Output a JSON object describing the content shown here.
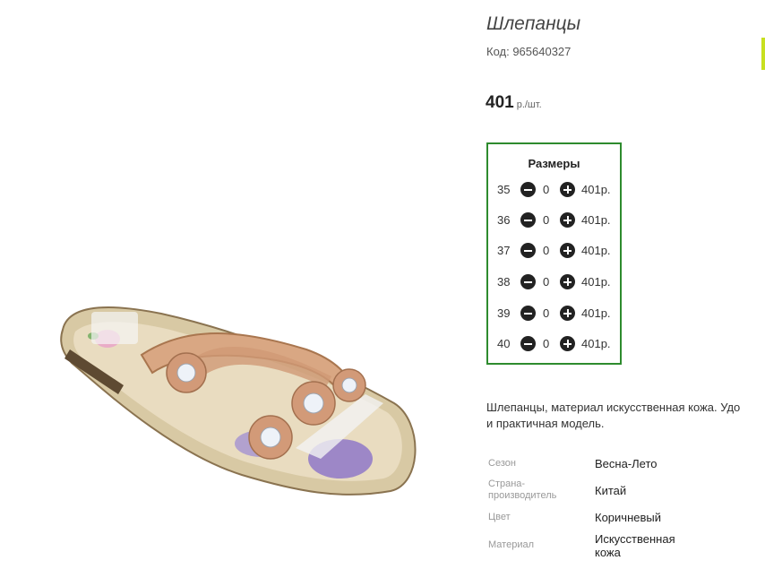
{
  "product": {
    "title": "Шлепанцы",
    "code": "Код: 965640327",
    "price": "401",
    "price_unit": "р./шт."
  },
  "sizes": {
    "title": "Размеры",
    "rows": [
      {
        "size": "35",
        "qty": "0",
        "price": "401р."
      },
      {
        "size": "36",
        "qty": "0",
        "price": "401р."
      },
      {
        "size": "37",
        "qty": "0",
        "price": "401р."
      },
      {
        "size": "38",
        "qty": "0",
        "price": "401р."
      },
      {
        "size": "39",
        "qty": "0",
        "price": "401р."
      },
      {
        "size": "40",
        "qty": "0",
        "price": "401р."
      }
    ]
  },
  "description": "Шлепанцы, материал искусственная кожа. Удо\nи практичная модель.",
  "specs": [
    {
      "label": "Сезон",
      "value": "Весна-Лето"
    },
    {
      "label": "Страна-\nпроизводитель",
      "value": "Китай"
    },
    {
      "label": "Цвет",
      "value": "Коричневый"
    },
    {
      "label": "Материал",
      "value": "Искусственная\nкожа"
    }
  ],
  "icons": {
    "minus": "minus-circle-icon",
    "plus": "plus-circle-icon"
  },
  "colors": {
    "sizes_border": "#2e8b2e",
    "accent_edge": "#c8e020"
  }
}
